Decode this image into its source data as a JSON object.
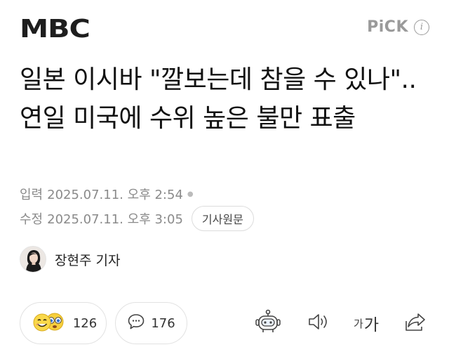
{
  "header": {
    "logo_text": "MBC",
    "pick_label": "PiCK",
    "info_glyph": "i"
  },
  "article": {
    "title": "일본 이시바 \"깔보는데 참을 수 있나\"..연일 미국에 수위 높은 불만 표출",
    "input_label": "입력",
    "input_datetime": "2025.07.11. 오후 2:54",
    "modified_label": "수정",
    "modified_datetime": "2025.07.11. 오후 3:05",
    "original_button": "기사원문",
    "reporter": "장현주 기자"
  },
  "actions": {
    "reaction_count": "126",
    "comment_count": "176",
    "font_small": "가",
    "font_big": "가"
  },
  "icons": {
    "info": "info-icon",
    "reactions": "emoji-reaction-icon",
    "comment": "speech-bubble-icon",
    "summary_bot": "robot-icon",
    "tts": "speaker-icon",
    "share": "share-icon"
  },
  "colors": {
    "text": "#111111",
    "muted": "#8a8a8a",
    "border": "#e2e2e2",
    "emoji_yellow": "#f7cf3d"
  }
}
